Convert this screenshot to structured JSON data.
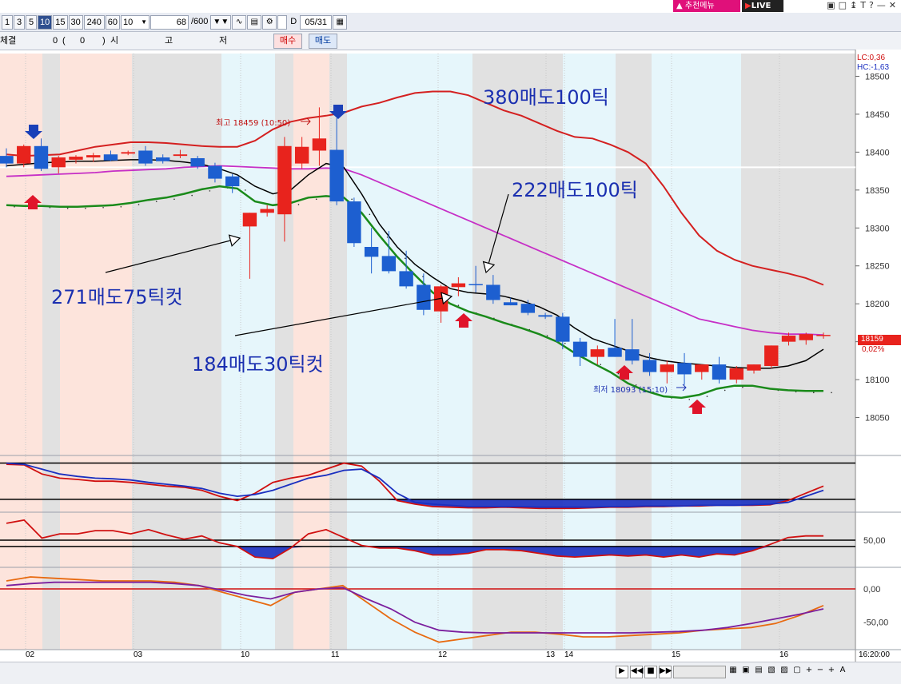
{
  "top": {
    "recommend_label": "추천메뉴",
    "live_label": "LIVE",
    "icons": [
      "restore-icon",
      "window-icon",
      "pin-icon",
      "text-icon",
      "help-icon",
      "minimize-icon",
      "close-icon"
    ]
  },
  "toolbar": {
    "periods": [
      "1",
      "3",
      "5",
      "10",
      "15",
      "30",
      "240",
      "60"
    ],
    "active_period": "10",
    "period_select": "10",
    "count_field": "68",
    "count_total": "/600",
    "d_label": "D",
    "date_value": "05/31"
  },
  "row2": {
    "left_label": "체결",
    "zero_value": "0",
    "paren_open": "(",
    "paren_value": "0",
    "paren_close": ")",
    "si": "시",
    "go": "고",
    "jeo": "저",
    "buy_label": "매수",
    "sell_label": "매도"
  },
  "right_info": {
    "lc": "LC:0,36",
    "hc": "HC:-1,63",
    "current_price": "18159",
    "current_pct": "0,02%"
  },
  "annotations": {
    "a380": "380매도100틱",
    "a222": "222매도100틱",
    "a271": "271매도75틱컷",
    "a184": "184매도30틱컷",
    "high_label": "최고 18459 (10:50)",
    "low_label": "최저 18093 (15:10)"
  },
  "time_axis": {
    "labels": [
      "02",
      "03",
      "10",
      "11",
      "12",
      "13",
      "14",
      "15",
      "16"
    ],
    "end_time": "16:20:00"
  },
  "colors": {
    "up": "#e8231d",
    "down": "#1d5fd0",
    "bg_pink": "#fde4dc",
    "bg_gray": "#e1e1e1",
    "bg_blue": "#e6f6fb",
    "envelope_upper": "#d42020",
    "envelope_lower": "#1a8a1a",
    "ma_mid": "#c62fc6",
    "ma_fast": "#000000",
    "annotation_text": "#1a2fb0"
  },
  "chart_data": [
    {
      "type": "candlestick",
      "ylim": [
        18000,
        18530
      ],
      "y_ticks": [
        18050,
        18100,
        18150,
        18200,
        18250,
        18300,
        18350,
        18400,
        18450,
        18500
      ],
      "candles": [
        {
          "o": 18395,
          "h": 18405,
          "l": 18380,
          "c": 18385
        },
        {
          "o": 18385,
          "h": 18410,
          "l": 18380,
          "c": 18408
        },
        {
          "o": 18408,
          "h": 18418,
          "l": 18375,
          "c": 18378
        },
        {
          "o": 18380,
          "h": 18395,
          "l": 18372,
          "c": 18393
        },
        {
          "o": 18390,
          "h": 18396,
          "l": 18385,
          "c": 18394
        },
        {
          "o": 18393,
          "h": 18399,
          "l": 18387,
          "c": 18396
        },
        {
          "o": 18397,
          "h": 18402,
          "l": 18388,
          "c": 18389
        },
        {
          "o": 18398,
          "h": 18402,
          "l": 18396,
          "c": 18400
        },
        {
          "o": 18402,
          "h": 18408,
          "l": 18382,
          "c": 18385
        },
        {
          "o": 18393,
          "h": 18397,
          "l": 18385,
          "c": 18388
        },
        {
          "o": 18395,
          "h": 18403,
          "l": 18392,
          "c": 18397
        },
        {
          "o": 18392,
          "h": 18395,
          "l": 18378,
          "c": 18381
        },
        {
          "o": 18382,
          "h": 18386,
          "l": 18360,
          "c": 18365
        },
        {
          "o": 18368,
          "h": 18371,
          "l": 18346,
          "c": 18355
        },
        {
          "o": 18302,
          "h": 18320,
          "l": 18233,
          "c": 18320
        },
        {
          "o": 18320,
          "h": 18330,
          "l": 18315,
          "c": 18325
        },
        {
          "o": 18318,
          "h": 18420,
          "l": 18282,
          "c": 18408
        },
        {
          "o": 18385,
          "h": 18420,
          "l": 18378,
          "c": 18407
        },
        {
          "o": 18402,
          "h": 18459,
          "l": 18382,
          "c": 18418
        },
        {
          "o": 18403,
          "h": 18445,
          "l": 18330,
          "c": 18335
        },
        {
          "o": 18335,
          "h": 18340,
          "l": 18275,
          "c": 18280
        },
        {
          "o": 18275,
          "h": 18300,
          "l": 18240,
          "c": 18262
        },
        {
          "o": 18263,
          "h": 18296,
          "l": 18240,
          "c": 18243
        },
        {
          "o": 18243,
          "h": 18270,
          "l": 18220,
          "c": 18223
        },
        {
          "o": 18225,
          "h": 18240,
          "l": 18185,
          "c": 18192
        },
        {
          "o": 18190,
          "h": 18225,
          "l": 18175,
          "c": 18223
        },
        {
          "o": 18222,
          "h": 18235,
          "l": 18210,
          "c": 18227
        },
        {
          "o": 18226,
          "h": 18250,
          "l": 18215,
          "c": 18225
        },
        {
          "o": 18225,
          "h": 18238,
          "l": 18200,
          "c": 18205
        },
        {
          "o": 18202,
          "h": 18208,
          "l": 18198,
          "c": 18198
        },
        {
          "o": 18200,
          "h": 18205,
          "l": 18185,
          "c": 18188
        },
        {
          "o": 18185,
          "h": 18188,
          "l": 18180,
          "c": 18183
        },
        {
          "o": 18183,
          "h": 18188,
          "l": 18140,
          "c": 18150
        },
        {
          "o": 18150,
          "h": 18155,
          "l": 18118,
          "c": 18130
        },
        {
          "o": 18130,
          "h": 18145,
          "l": 18120,
          "c": 18140
        },
        {
          "o": 18142,
          "h": 18180,
          "l": 18130,
          "c": 18130
        },
        {
          "o": 18140,
          "h": 18180,
          "l": 18120,
          "c": 18125
        },
        {
          "o": 18126,
          "h": 18135,
          "l": 18105,
          "c": 18110
        },
        {
          "o": 18110,
          "h": 18125,
          "l": 18095,
          "c": 18120
        },
        {
          "o": 18122,
          "h": 18135,
          "l": 18093,
          "c": 18107
        },
        {
          "o": 18110,
          "h": 18120,
          "l": 18100,
          "c": 18120
        },
        {
          "o": 18120,
          "h": 18130,
          "l": 18095,
          "c": 18100
        },
        {
          "o": 18100,
          "h": 18118,
          "l": 18095,
          "c": 18115
        },
        {
          "o": 18112,
          "h": 18120,
          "l": 18108,
          "c": 18120
        },
        {
          "o": 18118,
          "h": 18145,
          "l": 18115,
          "c": 18145
        },
        {
          "o": 18150,
          "h": 18162,
          "l": 18145,
          "c": 18158
        },
        {
          "o": 18152,
          "h": 18162,
          "l": 18146,
          "c": 18160
        },
        {
          "o": 18158,
          "h": 18162,
          "l": 18154,
          "c": 18159
        }
      ],
      "upper_band": [
        18397,
        18395,
        18396,
        18397,
        18402,
        18407,
        18410,
        18413,
        18413,
        18412,
        18410,
        18408,
        18407,
        18407,
        18415,
        18430,
        18440,
        18445,
        18448,
        18452,
        18460,
        18465,
        18472,
        18478,
        18480,
        18480,
        18475,
        18465,
        18455,
        18448,
        18438,
        18428,
        18420,
        18418,
        18410,
        18400,
        18385,
        18355,
        18320,
        18290,
        18270,
        18258,
        18250,
        18245,
        18240,
        18234,
        18225
      ],
      "ma_mid": [
        18368,
        18369,
        18370,
        18371,
        18372,
        18373,
        18375,
        18376,
        18377,
        18378,
        18380,
        18381,
        18382,
        18381,
        18380,
        18379,
        18378,
        18378,
        18379,
        18378,
        18370,
        18360,
        18350,
        18340,
        18330,
        18320,
        18310,
        18300,
        18290,
        18280,
        18270,
        18260,
        18250,
        18240,
        18230,
        18220,
        18210,
        18200,
        18190,
        18180,
        18175,
        18170,
        18165,
        18162,
        18160,
        18160,
        18159
      ],
      "ma_fast": [
        18382,
        18384,
        18386,
        18387,
        18388,
        18388,
        18389,
        18390,
        18390,
        18389,
        18387,
        18384,
        18378,
        18370,
        18355,
        18345,
        18350,
        18370,
        18385,
        18380,
        18345,
        18305,
        18275,
        18252,
        18235,
        18220,
        18215,
        18213,
        18210,
        18204,
        18196,
        18185,
        18168,
        18154,
        18146,
        18138,
        18130,
        18125,
        18122,
        18120,
        18118,
        18116,
        18115,
        18115,
        18118,
        18125,
        18140
      ],
      "lower_band": [
        18330,
        18329,
        18329,
        18328,
        18328,
        18329,
        18330,
        18333,
        18337,
        18340,
        18345,
        18351,
        18355,
        18352,
        18335,
        18330,
        18333,
        18340,
        18342,
        18340,
        18320,
        18290,
        18262,
        18238,
        18215,
        18200,
        18190,
        18183,
        18175,
        18168,
        18160,
        18150,
        18135,
        18122,
        18110,
        18095,
        18085,
        18078,
        18076,
        18080,
        18088,
        18092,
        18092,
        18088,
        18086,
        18085,
        18085
      ]
    },
    {
      "type": "line",
      "series": [
        {
          "color": "#d01010",
          "values": [
            78,
            77,
            62,
            55,
            53,
            50,
            50,
            48,
            45,
            42,
            40,
            35,
            25,
            18,
            30,
            48,
            55,
            60,
            70,
            80,
            75,
            50,
            18,
            12,
            8,
            7,
            6,
            6,
            7,
            6,
            5,
            5,
            5,
            6,
            7,
            7,
            8,
            8,
            9,
            9,
            10,
            10,
            10,
            11,
            18,
            30,
            42
          ]
        },
        {
          "color": "#1a2fc0",
          "values": [
            80,
            78,
            70,
            62,
            58,
            55,
            54,
            52,
            48,
            45,
            42,
            38,
            30,
            25,
            28,
            35,
            45,
            55,
            60,
            68,
            70,
            55,
            30,
            15,
            12,
            10,
            8,
            8,
            8,
            8,
            7,
            7,
            7,
            7,
            8,
            8,
            9,
            9,
            9,
            10,
            10,
            10,
            11,
            12,
            15,
            25,
            35
          ]
        }
      ],
      "hlines": [
        80,
        20
      ]
    },
    {
      "type": "line",
      "y_ticks": [
        50
      ],
      "series": [
        {
          "color": "#d01010",
          "values": [
            82,
            88,
            54,
            62,
            62,
            68,
            68,
            62,
            70,
            60,
            52,
            58,
            45,
            38,
            18,
            15,
            35,
            62,
            70,
            55,
            40,
            35,
            35,
            30,
            22,
            22,
            25,
            32,
            32,
            30,
            25,
            20,
            18,
            20,
            22,
            20,
            22,
            18,
            22,
            18,
            24,
            22,
            30,
            42,
            55,
            58,
            58
          ]
        }
      ],
      "hlines": [
        50,
        38
      ]
    },
    {
      "type": "line",
      "y_ticks": [
        0,
        -50
      ],
      "series": [
        {
          "color": "#e86a10",
          "values": [
            12,
            18,
            16,
            14,
            12,
            12,
            12,
            10,
            5,
            -5,
            -15,
            -25,
            -5,
            0,
            5,
            -20,
            -45,
            -65,
            -80,
            -75,
            -70,
            -65,
            -65,
            -68,
            -72,
            -72,
            -70,
            -68,
            -66,
            -62,
            -60,
            -58,
            -52,
            -40,
            -25
          ]
        },
        {
          "color": "#7b1f9e",
          "values": [
            5,
            8,
            10,
            10,
            10,
            10,
            10,
            8,
            5,
            -2,
            -10,
            -15,
            -5,
            0,
            2,
            -15,
            -30,
            -50,
            -62,
            -65,
            -66,
            -66,
            -66,
            -66,
            -66,
            -66,
            -66,
            -65,
            -64,
            -62,
            -58,
            -52,
            -45,
            -38,
            -30
          ]
        }
      ],
      "hlines": [
        0
      ]
    }
  ]
}
